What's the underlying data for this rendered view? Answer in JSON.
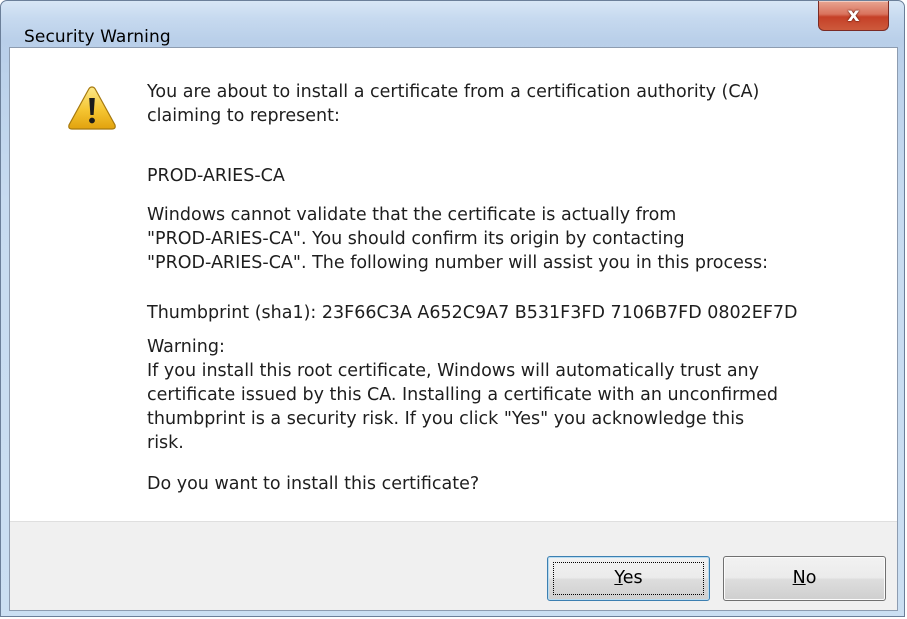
{
  "window": {
    "title": "Security Warning",
    "close_glyph": "x"
  },
  "content": {
    "icon": "warning-triangle-icon",
    "intro_line1": "You are about to install a certificate from a certification authority (CA)",
    "intro_line2": "claiming to represent:",
    "ca_name": "PROD-ARIES-CA",
    "validate_line1": "Windows cannot validate that the certificate is actually from",
    "validate_line2": "\"PROD-ARIES-CA\". You should confirm its origin by contacting",
    "validate_line3": "\"PROD-ARIES-CA\". The following number will assist you in this process:",
    "thumbprint": "Thumbprint (sha1): 23F66C3A A652C9A7 B531F3FD 7106B7FD 0802EF7D",
    "warning_heading": "Warning:",
    "warning_line1": "If you install this root certificate, Windows will automatically trust any",
    "warning_line2": "certificate issued by this CA. Installing a certificate with an unconfirmed",
    "warning_line3": "thumbprint is a security risk. If you click \"Yes\" you acknowledge this",
    "warning_line4": "risk.",
    "question": "Do you want to install this certificate?"
  },
  "buttons": {
    "yes": {
      "mnemonic": "Y",
      "rest": "es"
    },
    "no": {
      "mnemonic": "N",
      "rest": "o"
    }
  },
  "colors": {
    "title_bar": "#c6d9ef",
    "close_button": "#c54027",
    "default_button_border": "#3c7fb1",
    "warning_icon_fill": "#f5c531"
  }
}
